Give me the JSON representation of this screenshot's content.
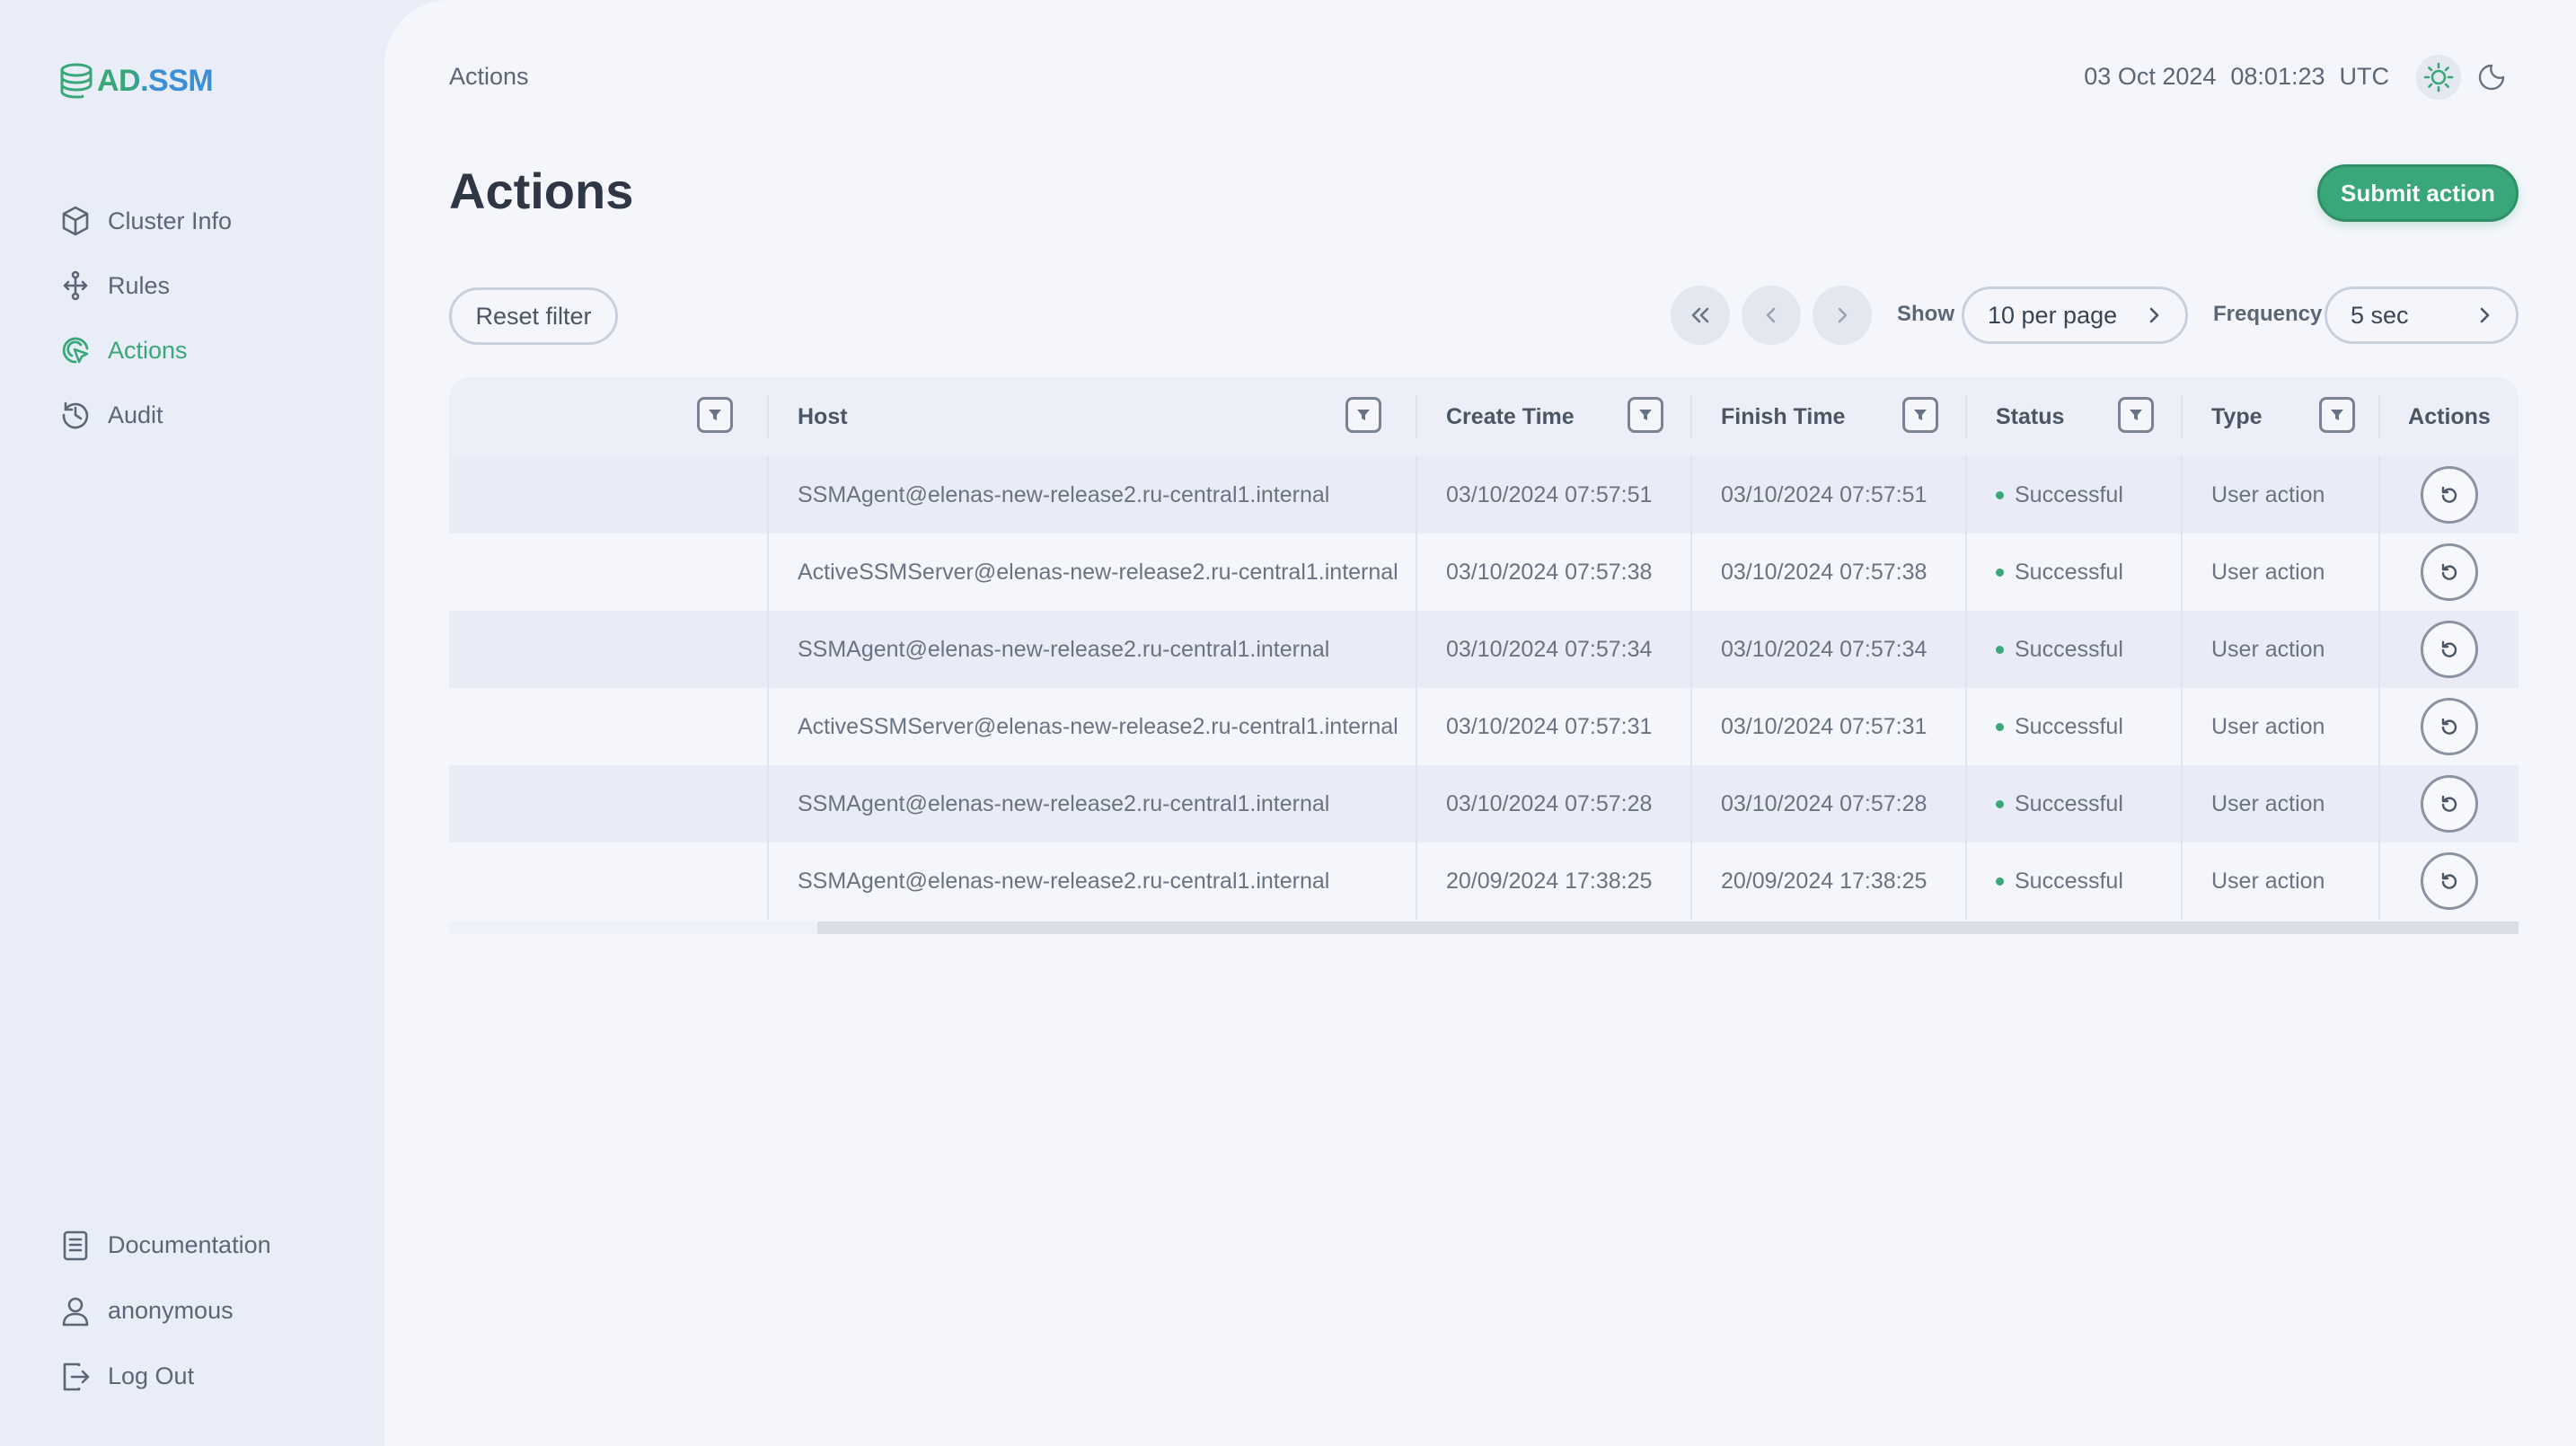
{
  "app": {
    "logo_text": "AD.SSM"
  },
  "sidebar": {
    "items": [
      {
        "label": "Cluster Info",
        "icon": "cube-icon"
      },
      {
        "label": "Rules",
        "icon": "flow-icon"
      },
      {
        "label": "Actions",
        "icon": "actions-icon",
        "active": true
      },
      {
        "label": "Audit",
        "icon": "audit-icon"
      }
    ],
    "bottom": [
      {
        "label": "Documentation",
        "icon": "document-icon"
      },
      {
        "label": "anonymous",
        "icon": "user-icon"
      },
      {
        "label": "Log Out",
        "icon": "logout-icon"
      }
    ]
  },
  "header": {
    "breadcrumb": "Actions",
    "date": "03 Oct 2024",
    "time": "08:01:23",
    "tz": "UTC"
  },
  "page": {
    "title": "Actions",
    "submit_label": "Submit action",
    "reset_label": "Reset filter"
  },
  "pagination": {
    "show_label": "Show",
    "per_page": "10 per page",
    "frequency_label": "Frequency",
    "frequency": "5 sec"
  },
  "table": {
    "columns": [
      "",
      "Host",
      "Create Time",
      "Finish Time",
      "Status",
      "Type",
      "Actions"
    ],
    "rows": [
      {
        "host": "SSMAgent@elenas-new-release2.ru-central1.internal",
        "create": "03/10/2024 07:57:51",
        "finish": "03/10/2024 07:57:51",
        "status": "Successful",
        "type": "User action"
      },
      {
        "host": "ActiveSSMServer@elenas-new-release2.ru-central1.internal",
        "create": "03/10/2024 07:57:38",
        "finish": "03/10/2024 07:57:38",
        "status": "Successful",
        "type": "User action"
      },
      {
        "host": "SSMAgent@elenas-new-release2.ru-central1.internal",
        "create": "03/10/2024 07:57:34",
        "finish": "03/10/2024 07:57:34",
        "status": "Successful",
        "type": "User action"
      },
      {
        "host": "ActiveSSMServer@elenas-new-release2.ru-central1.internal",
        "create": "03/10/2024 07:57:31",
        "finish": "03/10/2024 07:57:31",
        "status": "Successful",
        "type": "User action"
      },
      {
        "host": "SSMAgent@elenas-new-release2.ru-central1.internal",
        "create": "03/10/2024 07:57:28",
        "finish": "03/10/2024 07:57:28",
        "status": "Successful",
        "type": "User action"
      },
      {
        "host": "SSMAgent@elenas-new-release2.ru-central1.internal",
        "create": "20/09/2024 17:38:25",
        "finish": "20/09/2024 17:38:25",
        "status": "Successful",
        "type": "User action"
      }
    ]
  },
  "colors": {
    "accent": "#3aa77a",
    "logo_blue": "#3c8fd4",
    "status_success": "#3aa77a"
  }
}
